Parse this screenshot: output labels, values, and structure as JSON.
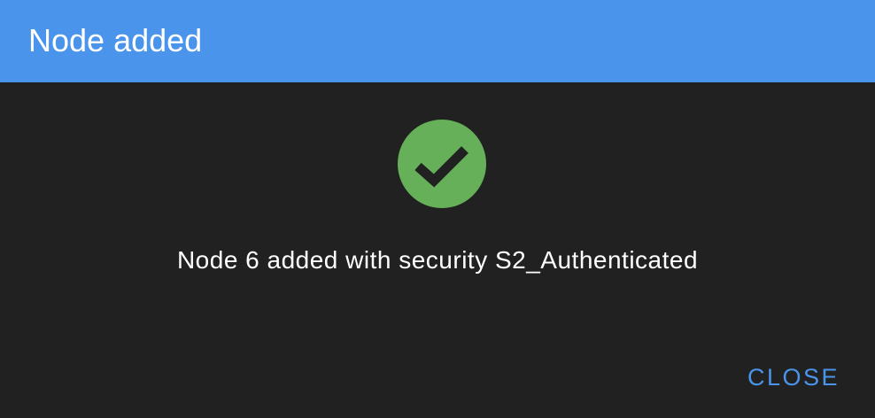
{
  "dialog": {
    "title": "Node added",
    "message": "Node 6 added with security S2_Authenticated",
    "close_label": "CLOSE",
    "status_icon": "check-circle-icon"
  },
  "colors": {
    "header_background": "#4a95eb",
    "dialog_background": "#212121",
    "success_icon": "#66b05a",
    "checkmark": "#212121",
    "text": "#ffffff",
    "button_text": "#4a95eb"
  }
}
